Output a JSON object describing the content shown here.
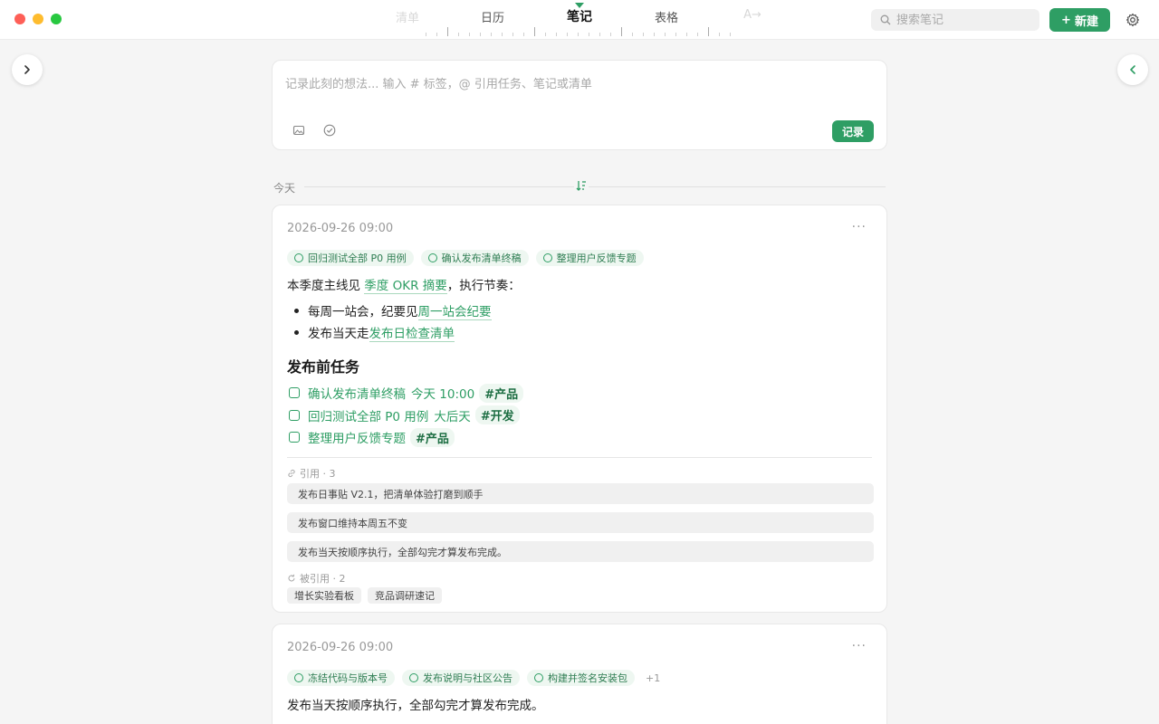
{
  "window": {
    "view_tabs": [
      {
        "label": "清单",
        "state": "faded"
      },
      {
        "label": "日历",
        "state": "normal"
      },
      {
        "label": "笔记",
        "state": "active"
      },
      {
        "label": "表格",
        "state": "normal"
      },
      {
        "label": "A→",
        "state": "faded"
      }
    ]
  },
  "header": {
    "search_placeholder": "搜索笔记",
    "new_label": "新建",
    "new_icon": "+"
  },
  "composer": {
    "placeholder": "记录此刻的想法... 输入 # 标签，@ 引用任务、笔记或清单",
    "submit_label": "记录"
  },
  "section": {
    "label": "今天"
  },
  "notes": [
    {
      "date": "2026-09-26 09:00",
      "more": "···",
      "chips": [
        "回归测试全部 P0 用例",
        "确认发布清单终稿",
        "整理用户反馈专题"
      ],
      "intro": {
        "before": "本季度主线见 ",
        "link": "季度 OKR 摘要",
        "after": "，执行节奏："
      },
      "bullets": [
        {
          "text": "每周一站会，纪要见 ",
          "link": "周一站会纪要"
        },
        {
          "text": "发布当天走 ",
          "link": "发布日检查清单"
        }
      ],
      "heading": "发布前任务",
      "tasks": [
        {
          "title": "确认发布清单终稿",
          "due": "今天 10:00",
          "tag": "#产品"
        },
        {
          "title": "回归测试全部 P0 用例",
          "due": "大后天",
          "tag": "#开发"
        },
        {
          "title": "整理用户反馈专题",
          "due": "",
          "tag": "#产品"
        }
      ],
      "refs_label": "引用 · 3",
      "refs": [
        "发布日事贴 V2.1，把清单体验打磨到顺手",
        "发布窗口维持本周五不变",
        "发布当天按顺序执行，全部勾完才算发布完成。"
      ],
      "backrefs_label": "被引用 · 2",
      "backrefs": [
        "增长实验看板",
        "竞品调研速记"
      ]
    },
    {
      "date": "2026-09-26 09:00",
      "more": "···",
      "chips": [
        "冻结代码与版本号",
        "发布说明与社区公告",
        "构建并签名安装包"
      ],
      "chips_more": "+1",
      "body": "发布当天按顺序执行，全部勾完才算发布完成。"
    }
  ],
  "colors": {
    "accent": "#2e9e64",
    "background": "#f5f5f5"
  }
}
